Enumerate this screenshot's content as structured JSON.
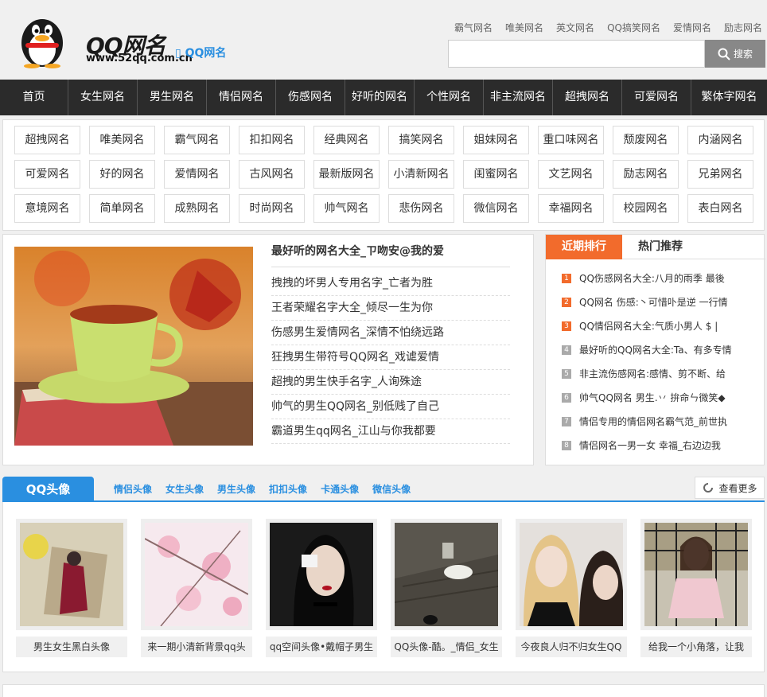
{
  "header": {
    "logo_text": "QQ网名",
    "logo_url": "www.52qq.com.cn",
    "mobile_link": "QQ网名",
    "top_links": [
      "霸气网名",
      "唯美网名",
      "英文网名",
      "QQ搞笑网名",
      "爱情网名",
      "励志网名"
    ],
    "search_button": "搜索"
  },
  "nav": [
    "首页",
    "女生网名",
    "男生网名",
    "情侣网名",
    "伤感网名",
    "好听的网名",
    "个性网名",
    "非主流网名",
    "超拽网名",
    "可爱网名",
    "繁体字网名"
  ],
  "tags": [
    [
      "超拽网名",
      "唯美网名",
      "霸气网名",
      "扣扣网名",
      "经典网名",
      "搞笑网名",
      "姐妹网名",
      "重口味网名",
      "颓废网名",
      "内涵网名"
    ],
    [
      "可爱网名",
      "好的网名",
      "爱情网名",
      "古风网名",
      "最新版网名",
      "小清新网名",
      "闺蜜网名",
      "文艺网名",
      "励志网名",
      "兄弟网名"
    ],
    [
      "意境网名",
      "简单网名",
      "成熟网名",
      "时尚网名",
      "帅气网名",
      "悲伤网名",
      "微信网名",
      "幸福网名",
      "校园网名",
      "表白网名"
    ]
  ],
  "featured": {
    "title": "最好听的网名大全_ㄗ吻安@我的爱",
    "items": [
      "拽拽的坏男人专用名字_亡者为胜",
      "王者荣耀名字大全_倾尽一生为你",
      "伤感男生爱情网名_深情不怕绕远路",
      "狂拽男生带符号QQ网名_戏谑爱情",
      "超拽的男生快手名字_人询殊途",
      "帅气的男生QQ网名_别低贱了自己",
      "霸道男生qq网名_江山与你我都要"
    ]
  },
  "ranking": {
    "tab_active": "近期排行",
    "tab_other": "热门推荐",
    "items": [
      {
        "num": "1",
        "text": "QQ伤感网名大全:八月的雨季 最後"
      },
      {
        "num": "2",
        "text": "QQ网名 伤感:丶可惜卟是逆 一行情"
      },
      {
        "num": "3",
        "text": "QQ情侣网名大全:气质小男人 $ |"
      },
      {
        "num": "4",
        "text": "最好听的QQ网名大全:Ta、有多专情"
      },
      {
        "num": "5",
        "text": "非主流伤感网名:感情、剪不断、给"
      },
      {
        "num": "6",
        "text": "帅气QQ网名 男生.丷 拚命ㄣ微笑◆"
      },
      {
        "num": "7",
        "text": "情侣专用的情侣网名霸气范_前世执"
      },
      {
        "num": "8",
        "text": "情侣网名一男一女 幸福_右边边我"
      }
    ]
  },
  "avatars": {
    "title": "QQ头像",
    "categories": [
      "情侣头像",
      "女生头像",
      "男生头像",
      "扣扣头像",
      "卡通头像",
      "微信头像"
    ],
    "more": "查看更多",
    "cards": [
      {
        "caption": "男生女生黑白头像"
      },
      {
        "caption": "来一期小清新背景qq头"
      },
      {
        "caption": "qq空间头像•戴帽子男生"
      },
      {
        "caption": "QQ头像-酷。_情侣_女生"
      },
      {
        "caption": "今夜良人归不归女生QQ"
      },
      {
        "caption": "给我一个小角落，让我"
      }
    ]
  },
  "colors": {
    "accent": "#2a8fe0",
    "rank": "#f26b2c",
    "nav": "#2b2b2b"
  }
}
